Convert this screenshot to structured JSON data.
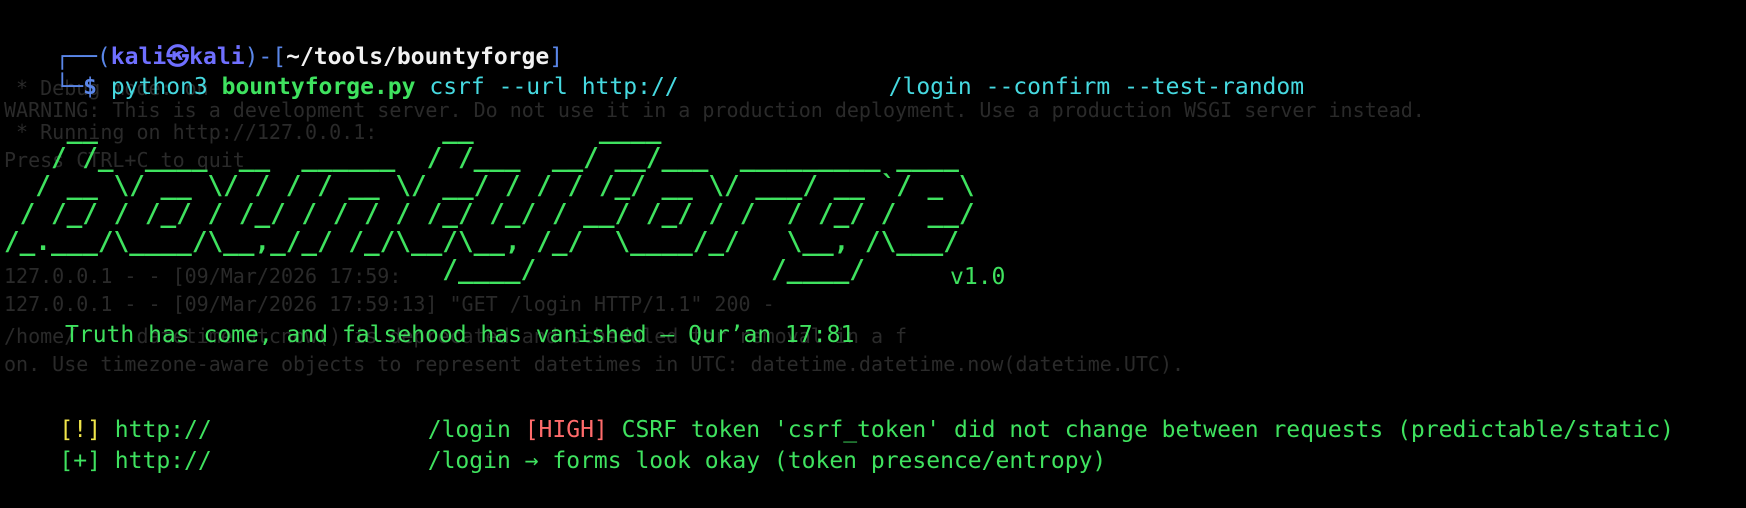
{
  "prompt": {
    "frame_top_left": "┌──(",
    "user": "kali",
    "at_symbol": "㉿",
    "host": "kali",
    "frame_mid": ")-[",
    "path": "~/tools/bountyforge",
    "frame_end": "]",
    "frame_bottom": "└─",
    "dollar": "$",
    "command_bin": "python3",
    "script_name": "bountyforge.py",
    "subcommand": "csrf",
    "url_flag": "--url",
    "url_start": "http://",
    "url_end": "/login",
    "flag_confirm": "--confirm",
    "flag_test_random": "--test-random"
  },
  "background_noise": [
    " * Debug mode: on",
    "WARNING: This is a development server. Do not use it in a production deployment. Use a production WSGI server instead.",
    " * Running on http://127.0.0.1:",
    "Press CTRL+C to quit",
    "127.0.0.1 - - [09/Mar/2026 17:59:",
    "127.0.0.1 - - [09/Mar/2026 17:59:13] \"GET /login HTTP/1.1\" 200 -",
    "/home/     datetime.utcnow() is deprecated and scheduled for removal in a f",
    "on. Use timezone-aware objects to represent datetimes in UTC: datetime.datetime.now(datetime.UTC)."
  ],
  "banner": {
    "art_lines": [
      "    __                      __        ____                     ",
      "   / /_  ____  __  ______  / /___  __/ __/___  _________ ____ ",
      "  / __ \\/ __ \\/ / / / __ \\/ __/ / / / /_/ __ \\/ ___/ __ `/ _ \\",
      " / /_/ / /_/ / /_/ / / / / /_/ /_/ / __/ /_/ / /  / /_/ /  __/",
      "/_.___/\\____/\\__,_/_/ /_/\\__/\\__, /_/  \\____/_/   \\__, /\\___/ ",
      "                            /____/               /____/       "
    ],
    "version": "v1.0",
    "quote": "Truth has come, and falsehood has vanished — Qur’an 17:81"
  },
  "results": [
    {
      "marker": "[!]",
      "url_start": "http://",
      "url_end": "/login",
      "severity": "[HIGH]",
      "message": "CSRF token 'csrf_token' did not change between requests (predictable/static)"
    },
    {
      "marker": "[+]",
      "url_start": "http://",
      "url_end": "/login",
      "message": "→ forms look okay (token presence/entropy)"
    }
  ],
  "colors": {
    "background": "#000000",
    "prompt_frame": "#5a86e8",
    "user_host": "#6f6fff",
    "command": "#46d9e0",
    "green": "#3fe25f",
    "warning_marker": "#f0e54a",
    "severity_high": "#ff6b6b"
  }
}
